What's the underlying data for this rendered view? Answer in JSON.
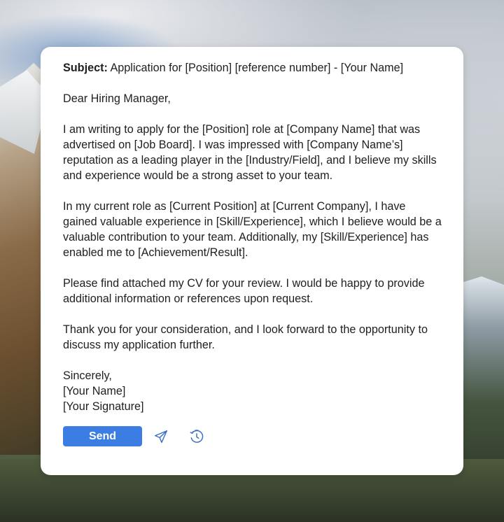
{
  "email": {
    "subject_label": "Subject:",
    "subject_text": " Application for [Position] [reference number] - [Your Name]",
    "greeting": "Dear Hiring Manager,",
    "paragraphs": [
      "I am writing to apply for the [Position] role at [Company Name] that was advertised on [Job Board]. I was impressed with [Company Name’s] reputation as a leading player in the [Industry/Field], and I believe my skills and experience would be a strong asset to your team.",
      "In my current role as [Current Position] at [Current Company], I have gained valuable experience in [Skill/Experience], which I believe would be a valuable contribution to your team. Additionally, my [Skill/Experience] has enabled me to [Achievement/Result].",
      "Please find attached my CV for your review. I would be happy to provide additional information or references upon request.",
      "Thank you for your consideration, and I look forward to the opportunity to discuss my application further."
    ],
    "closing": "Sincerely,",
    "name_line": "[Your Name]",
    "signature_line": "[Your Signature]"
  },
  "actions": {
    "send_label": "Send",
    "send_icon": "paper-plane-icon",
    "schedule_icon": "clock-schedule-icon"
  },
  "colors": {
    "accent": "#3b7de3",
    "icon": "#3b6fc4",
    "text": "#1f1f1f",
    "card": "#ffffff"
  }
}
